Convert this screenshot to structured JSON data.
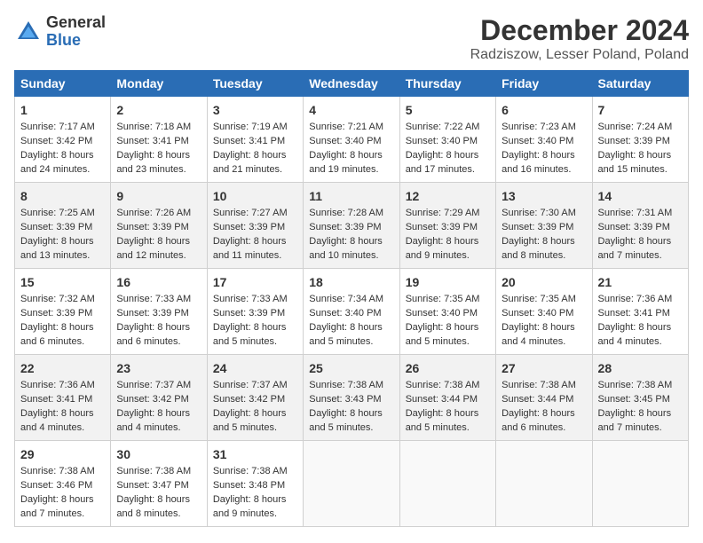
{
  "logo": {
    "general": "General",
    "blue": "Blue"
  },
  "title": "December 2024",
  "subtitle": "Radziszow, Lesser Poland, Poland",
  "days_of_week": [
    "Sunday",
    "Monday",
    "Tuesday",
    "Wednesday",
    "Thursday",
    "Friday",
    "Saturday"
  ],
  "weeks": [
    [
      {
        "day": 1,
        "sunrise": "7:17 AM",
        "sunset": "3:42 PM",
        "daylight": "8 hours and 24 minutes."
      },
      {
        "day": 2,
        "sunrise": "7:18 AM",
        "sunset": "3:41 PM",
        "daylight": "8 hours and 23 minutes."
      },
      {
        "day": 3,
        "sunrise": "7:19 AM",
        "sunset": "3:41 PM",
        "daylight": "8 hours and 21 minutes."
      },
      {
        "day": 4,
        "sunrise": "7:21 AM",
        "sunset": "3:40 PM",
        "daylight": "8 hours and 19 minutes."
      },
      {
        "day": 5,
        "sunrise": "7:22 AM",
        "sunset": "3:40 PM",
        "daylight": "8 hours and 17 minutes."
      },
      {
        "day": 6,
        "sunrise": "7:23 AM",
        "sunset": "3:40 PM",
        "daylight": "8 hours and 16 minutes."
      },
      {
        "day": 7,
        "sunrise": "7:24 AM",
        "sunset": "3:39 PM",
        "daylight": "8 hours and 15 minutes."
      }
    ],
    [
      {
        "day": 8,
        "sunrise": "7:25 AM",
        "sunset": "3:39 PM",
        "daylight": "8 hours and 13 minutes."
      },
      {
        "day": 9,
        "sunrise": "7:26 AM",
        "sunset": "3:39 PM",
        "daylight": "8 hours and 12 minutes."
      },
      {
        "day": 10,
        "sunrise": "7:27 AM",
        "sunset": "3:39 PM",
        "daylight": "8 hours and 11 minutes."
      },
      {
        "day": 11,
        "sunrise": "7:28 AM",
        "sunset": "3:39 PM",
        "daylight": "8 hours and 10 minutes."
      },
      {
        "day": 12,
        "sunrise": "7:29 AM",
        "sunset": "3:39 PM",
        "daylight": "8 hours and 9 minutes."
      },
      {
        "day": 13,
        "sunrise": "7:30 AM",
        "sunset": "3:39 PM",
        "daylight": "8 hours and 8 minutes."
      },
      {
        "day": 14,
        "sunrise": "7:31 AM",
        "sunset": "3:39 PM",
        "daylight": "8 hours and 7 minutes."
      }
    ],
    [
      {
        "day": 15,
        "sunrise": "7:32 AM",
        "sunset": "3:39 PM",
        "daylight": "8 hours and 6 minutes."
      },
      {
        "day": 16,
        "sunrise": "7:33 AM",
        "sunset": "3:39 PM",
        "daylight": "8 hours and 6 minutes."
      },
      {
        "day": 17,
        "sunrise": "7:33 AM",
        "sunset": "3:39 PM",
        "daylight": "8 hours and 5 minutes."
      },
      {
        "day": 18,
        "sunrise": "7:34 AM",
        "sunset": "3:40 PM",
        "daylight": "8 hours and 5 minutes."
      },
      {
        "day": 19,
        "sunrise": "7:35 AM",
        "sunset": "3:40 PM",
        "daylight": "8 hours and 5 minutes."
      },
      {
        "day": 20,
        "sunrise": "7:35 AM",
        "sunset": "3:40 PM",
        "daylight": "8 hours and 4 minutes."
      },
      {
        "day": 21,
        "sunrise": "7:36 AM",
        "sunset": "3:41 PM",
        "daylight": "8 hours and 4 minutes."
      }
    ],
    [
      {
        "day": 22,
        "sunrise": "7:36 AM",
        "sunset": "3:41 PM",
        "daylight": "8 hours and 4 minutes."
      },
      {
        "day": 23,
        "sunrise": "7:37 AM",
        "sunset": "3:42 PM",
        "daylight": "8 hours and 4 minutes."
      },
      {
        "day": 24,
        "sunrise": "7:37 AM",
        "sunset": "3:42 PM",
        "daylight": "8 hours and 5 minutes."
      },
      {
        "day": 25,
        "sunrise": "7:38 AM",
        "sunset": "3:43 PM",
        "daylight": "8 hours and 5 minutes."
      },
      {
        "day": 26,
        "sunrise": "7:38 AM",
        "sunset": "3:44 PM",
        "daylight": "8 hours and 5 minutes."
      },
      {
        "day": 27,
        "sunrise": "7:38 AM",
        "sunset": "3:44 PM",
        "daylight": "8 hours and 6 minutes."
      },
      {
        "day": 28,
        "sunrise": "7:38 AM",
        "sunset": "3:45 PM",
        "daylight": "8 hours and 7 minutes."
      }
    ],
    [
      {
        "day": 29,
        "sunrise": "7:38 AM",
        "sunset": "3:46 PM",
        "daylight": "8 hours and 7 minutes."
      },
      {
        "day": 30,
        "sunrise": "7:38 AM",
        "sunset": "3:47 PM",
        "daylight": "8 hours and 8 minutes."
      },
      {
        "day": 31,
        "sunrise": "7:38 AM",
        "sunset": "3:48 PM",
        "daylight": "8 hours and 9 minutes."
      },
      null,
      null,
      null,
      null
    ]
  ]
}
